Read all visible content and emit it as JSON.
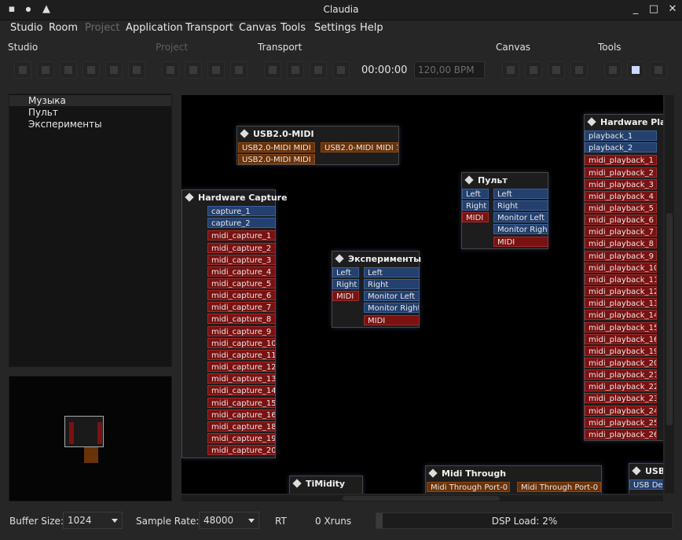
{
  "window": {
    "title": "Claudia"
  },
  "menu": [
    "Studio",
    "Room",
    "Project",
    "Application",
    "Transport",
    "Canvas",
    "Tools",
    "Settings",
    "Help"
  ],
  "toolbar": {
    "labels": {
      "studio": "Studio",
      "project": "Project",
      "transport": "Transport",
      "canvas": "Canvas",
      "tools": "Tools"
    },
    "clock": "00:00:00",
    "bpm": "120,00 BPM"
  },
  "rooms": [
    "Музыка",
    "Пульт",
    "Эксперименты"
  ],
  "canvas": {
    "usb_midi": {
      "title": "USB2.0-MIDI",
      "in1": "USB2.0-MIDI MIDI 1",
      "in2": "USB2.0-MIDI MIDI 2",
      "out1": "USB2.0-MIDI MIDI 1"
    },
    "capture": {
      "title": "Hardware Capture",
      "audio": [
        "capture_1",
        "capture_2"
      ],
      "midi": [
        "midi_capture_1",
        "midi_capture_2",
        "midi_capture_3",
        "midi_capture_4",
        "midi_capture_5",
        "midi_capture_6",
        "midi_capture_7",
        "midi_capture_8",
        "midi_capture_9",
        "midi_capture_10",
        "midi_capture_11",
        "midi_capture_12",
        "midi_capture_13",
        "midi_capture_14",
        "midi_capture_15",
        "midi_capture_16",
        "midi_capture_18",
        "midi_capture_19",
        "midi_capture_20"
      ]
    },
    "pult": {
      "title": "Пульт",
      "in": [
        "Left",
        "Right",
        "MIDI"
      ],
      "out": [
        "Left",
        "Right",
        "Monitor Left",
        "Monitor Right",
        "MIDI"
      ]
    },
    "exp": {
      "title": "Эксперименты",
      "in": [
        "Left",
        "Right",
        "MIDI"
      ],
      "out": [
        "Left",
        "Right",
        "Monitor Left",
        "Monitor Right",
        "MIDI"
      ]
    },
    "playback": {
      "title": "Hardware Playb",
      "audio": [
        "playback_1",
        "playback_2"
      ],
      "midi": [
        "midi_playback_1",
        "midi_playback_2",
        "midi_playback_3",
        "midi_playback_4",
        "midi_playback_5",
        "midi_playback_6",
        "midi_playback_7",
        "midi_playback_8",
        "midi_playback_9",
        "midi_playback_10",
        "midi_playback_11",
        "midi_playback_12",
        "midi_playback_13",
        "midi_playback_14",
        "midi_playback_15",
        "midi_playback_16",
        "midi_playback_19",
        "midi_playback_20",
        "midi_playback_21",
        "midi_playback_22",
        "midi_playback_23",
        "midi_playback_24",
        "midi_playback_25",
        "midi_playback_26"
      ]
    },
    "timidity": {
      "title": "TiMidity"
    },
    "midithrough": {
      "title": "Midi Through",
      "in": "Midi Through Port-0",
      "out": "Midi Through Port-0"
    },
    "usb": {
      "title": "USB",
      "port": "USB Dev"
    }
  },
  "status": {
    "buffer_label": "Buffer Size:",
    "buffer_value": "1024",
    "rate_label": "Sample Rate:",
    "rate_value": "48000",
    "rt": "RT",
    "xruns": "0 Xruns",
    "dsp": "DSP Load: 2%",
    "dsp_fraction": 0.02
  }
}
